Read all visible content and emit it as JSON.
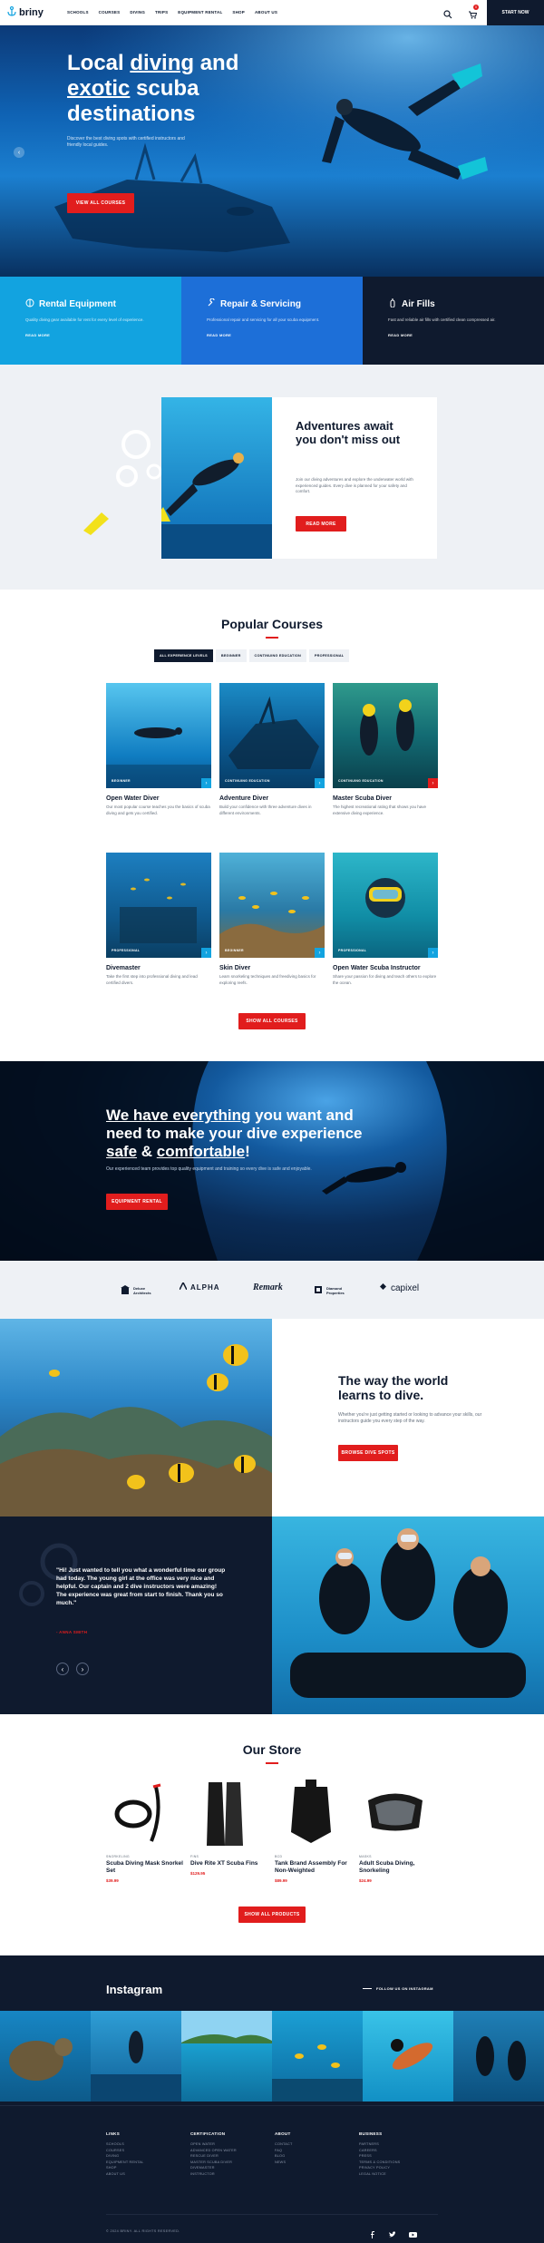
{
  "header": {
    "logo_text": "briny",
    "nav": [
      "SCHOOLS",
      "COURSES",
      "DIVING",
      "TRIPS",
      "EQUIPMENT RENTAL",
      "SHOP",
      "ABOUT US"
    ],
    "start_now": "START NOW",
    "cart_count": "0"
  },
  "hero": {
    "title_word_1": "Local",
    "title_word_2": "diving",
    "title_word_3": "and",
    "title_word_4": "exotic",
    "title_word_5": "scuba destinations",
    "subtitle": "Discover the best diving spots with certified instructors and friendly local guides.",
    "button": "VIEW ALL COURSES"
  },
  "services": [
    {
      "title": "Rental Equipment",
      "text": "Quality diving gear available for rent for every level of experience.",
      "more": "READ MORE",
      "color": "#12a3e0"
    },
    {
      "title": "Repair & Servicing",
      "text": "Professional repair and servicing for all your scuba equipment.",
      "more": "READ MORE",
      "color": "#1d6fd8"
    },
    {
      "title": "Air Fills",
      "text": "Fast and reliable air fills with certified clean compressed air.",
      "more": "READ MORE",
      "color": "#0f1a2e"
    }
  ],
  "adventures": {
    "title": "Adventures await you don't miss out",
    "text": "Join our diving adventures and explore the underwater world with experienced guides. Every dive is planned for your safety and comfort.",
    "button": "READ MORE"
  },
  "courses": {
    "title": "Popular Courses",
    "tabs": [
      "ALL EXPERIENCE LEVELS",
      "BEGINNER",
      "CONTINUING EDUCATION",
      "PROFESSIONAL"
    ],
    "items": [
      {
        "name": "Open Water Diver",
        "tag": "BEGINNER",
        "desc": "Our most popular course teaches you the basics of scuba diving and gets you certified.",
        "accent": "#12a3e0"
      },
      {
        "name": "Adventure Diver",
        "tag": "CONTINUING EDUCATION",
        "desc": "Build your confidence with three adventure dives in different environments.",
        "accent": "#12a3e0"
      },
      {
        "name": "Master Scuba Diver",
        "tag": "CONTINUING EDUCATION",
        "desc": "The highest recreational rating that shows you have extensive diving experience.",
        "accent": "#e11d1d"
      },
      {
        "name": "Divemaster",
        "tag": "PROFESSIONAL",
        "desc": "Take the first step into professional diving and lead certified divers.",
        "accent": "#12a3e0"
      },
      {
        "name": "Skin Diver",
        "tag": "BEGINNER",
        "desc": "Learn snorkeling techniques and freediving basics for exploring reefs.",
        "accent": "#12a3e0"
      },
      {
        "name": "Open Water Scuba Instructor",
        "tag": "PROFESSIONAL",
        "desc": "Share your passion for diving and teach others to explore the ocean.",
        "accent": "#12a3e0"
      }
    ],
    "button": "SHOW ALL COURSES"
  },
  "cave": {
    "line1_a": "We have everything",
    "line1_b": "you want and",
    "line2": "need to make your dive experience",
    "line3_a": "safe",
    "line3_b": "&",
    "line3_c": "comfortable",
    "line3_d": "!",
    "text": "Our experienced team provides top quality equipment and training so every dive is safe and enjoyable.",
    "button": "EQUIPMENT RENTAL"
  },
  "partners": [
    "Deluxe Architects",
    "ALPHA",
    "Remark",
    "Diamond Properties",
    "capixel"
  ],
  "way": {
    "title": "The way the world learns to dive.",
    "text": "Whether you're just getting started or looking to advance your skills, our instructors guide you every step of the way.",
    "button": "BROWSE DIVE SPOTS"
  },
  "testimonial": {
    "quote": "\"Hi! Just wanted to tell you what a wonderful time our group had today. The young girl at the office was very nice and helpful. Our captain and 2 dive instructors were amazing!",
    "quote2": "The experience was great from start to finish. Thank you so much.\"",
    "author": "- ANNA SMITH"
  },
  "store": {
    "title": "Our Store",
    "products": [
      {
        "category": "SNORKELING",
        "name": "Scuba Diving Mask Snorkel Set",
        "price": "$39.99"
      },
      {
        "category": "FINS",
        "name": "Dive Rite XT Scuba Fins",
        "price": "$129.95"
      },
      {
        "category": "BCD",
        "name": "Tank Brand Assembly For Non-Weighted",
        "price": "$89.99"
      },
      {
        "category": "MASKS",
        "name": "Adult Scuba Diving, Snorkeling",
        "price": "$24.99"
      }
    ],
    "button": "SHOW ALL PRODUCTS"
  },
  "instagram": {
    "title": "Instagram",
    "follow": "FOLLOW US ON INSTAGRAM"
  },
  "footer": {
    "columns": [
      {
        "head": "LINKS",
        "links": [
          "SCHOOLS",
          "COURSES",
          "DIVING",
          "EQUIPMENT RENTAL",
          "SHOP",
          "ABOUT US"
        ]
      },
      {
        "head": "CERTIFICATION",
        "links": [
          "OPEN WATER",
          "ADVANCED OPEN WATER",
          "RESCUE DIVER",
          "MASTER SCUBA DIVER",
          "DIVEMASTER",
          "INSTRUCTOR"
        ]
      },
      {
        "head": "ABOUT",
        "links": [
          "CONTACT",
          "FAQ",
          "BLOG",
          "NEWS"
        ]
      },
      {
        "head": "BUSINESS",
        "links": [
          "PARTNERS",
          "CAREERS",
          "PRESS",
          "TERMS & CONDITIONS",
          "PRIVACY POLICY",
          "LEGAL NOTICE"
        ]
      }
    ],
    "copyright": "© 2024 BRINY. ALL RIGHTS RESERVED."
  }
}
